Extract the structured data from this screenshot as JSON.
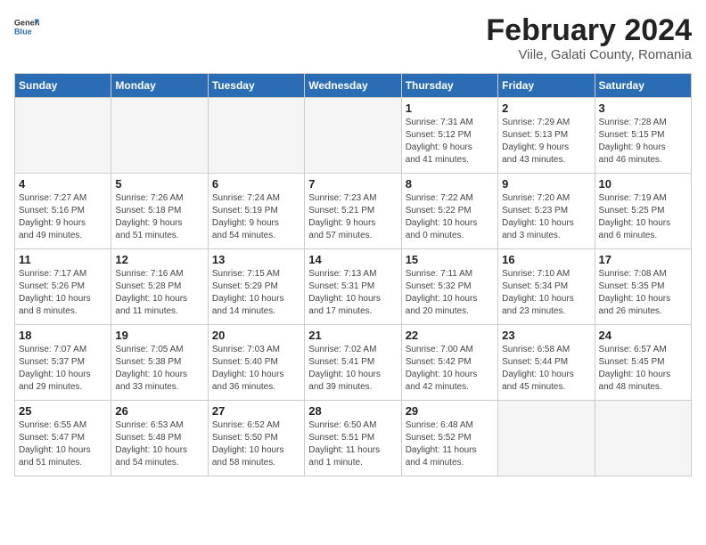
{
  "header": {
    "logo_general": "General",
    "logo_blue": "Blue",
    "month": "February 2024",
    "location": "Viile, Galati County, Romania"
  },
  "days_of_week": [
    "Sunday",
    "Monday",
    "Tuesday",
    "Wednesday",
    "Thursday",
    "Friday",
    "Saturday"
  ],
  "weeks": [
    [
      {
        "day": "",
        "info": ""
      },
      {
        "day": "",
        "info": ""
      },
      {
        "day": "",
        "info": ""
      },
      {
        "day": "",
        "info": ""
      },
      {
        "day": "1",
        "info": "Sunrise: 7:31 AM\nSunset: 5:12 PM\nDaylight: 9 hours\nand 41 minutes."
      },
      {
        "day": "2",
        "info": "Sunrise: 7:29 AM\nSunset: 5:13 PM\nDaylight: 9 hours\nand 43 minutes."
      },
      {
        "day": "3",
        "info": "Sunrise: 7:28 AM\nSunset: 5:15 PM\nDaylight: 9 hours\nand 46 minutes."
      }
    ],
    [
      {
        "day": "4",
        "info": "Sunrise: 7:27 AM\nSunset: 5:16 PM\nDaylight: 9 hours\nand 49 minutes."
      },
      {
        "day": "5",
        "info": "Sunrise: 7:26 AM\nSunset: 5:18 PM\nDaylight: 9 hours\nand 51 minutes."
      },
      {
        "day": "6",
        "info": "Sunrise: 7:24 AM\nSunset: 5:19 PM\nDaylight: 9 hours\nand 54 minutes."
      },
      {
        "day": "7",
        "info": "Sunrise: 7:23 AM\nSunset: 5:21 PM\nDaylight: 9 hours\nand 57 minutes."
      },
      {
        "day": "8",
        "info": "Sunrise: 7:22 AM\nSunset: 5:22 PM\nDaylight: 10 hours\nand 0 minutes."
      },
      {
        "day": "9",
        "info": "Sunrise: 7:20 AM\nSunset: 5:23 PM\nDaylight: 10 hours\nand 3 minutes."
      },
      {
        "day": "10",
        "info": "Sunrise: 7:19 AM\nSunset: 5:25 PM\nDaylight: 10 hours\nand 6 minutes."
      }
    ],
    [
      {
        "day": "11",
        "info": "Sunrise: 7:17 AM\nSunset: 5:26 PM\nDaylight: 10 hours\nand 8 minutes."
      },
      {
        "day": "12",
        "info": "Sunrise: 7:16 AM\nSunset: 5:28 PM\nDaylight: 10 hours\nand 11 minutes."
      },
      {
        "day": "13",
        "info": "Sunrise: 7:15 AM\nSunset: 5:29 PM\nDaylight: 10 hours\nand 14 minutes."
      },
      {
        "day": "14",
        "info": "Sunrise: 7:13 AM\nSunset: 5:31 PM\nDaylight: 10 hours\nand 17 minutes."
      },
      {
        "day": "15",
        "info": "Sunrise: 7:11 AM\nSunset: 5:32 PM\nDaylight: 10 hours\nand 20 minutes."
      },
      {
        "day": "16",
        "info": "Sunrise: 7:10 AM\nSunset: 5:34 PM\nDaylight: 10 hours\nand 23 minutes."
      },
      {
        "day": "17",
        "info": "Sunrise: 7:08 AM\nSunset: 5:35 PM\nDaylight: 10 hours\nand 26 minutes."
      }
    ],
    [
      {
        "day": "18",
        "info": "Sunrise: 7:07 AM\nSunset: 5:37 PM\nDaylight: 10 hours\nand 29 minutes."
      },
      {
        "day": "19",
        "info": "Sunrise: 7:05 AM\nSunset: 5:38 PM\nDaylight: 10 hours\nand 33 minutes."
      },
      {
        "day": "20",
        "info": "Sunrise: 7:03 AM\nSunset: 5:40 PM\nDaylight: 10 hours\nand 36 minutes."
      },
      {
        "day": "21",
        "info": "Sunrise: 7:02 AM\nSunset: 5:41 PM\nDaylight: 10 hours\nand 39 minutes."
      },
      {
        "day": "22",
        "info": "Sunrise: 7:00 AM\nSunset: 5:42 PM\nDaylight: 10 hours\nand 42 minutes."
      },
      {
        "day": "23",
        "info": "Sunrise: 6:58 AM\nSunset: 5:44 PM\nDaylight: 10 hours\nand 45 minutes."
      },
      {
        "day": "24",
        "info": "Sunrise: 6:57 AM\nSunset: 5:45 PM\nDaylight: 10 hours\nand 48 minutes."
      }
    ],
    [
      {
        "day": "25",
        "info": "Sunrise: 6:55 AM\nSunset: 5:47 PM\nDaylight: 10 hours\nand 51 minutes."
      },
      {
        "day": "26",
        "info": "Sunrise: 6:53 AM\nSunset: 5:48 PM\nDaylight: 10 hours\nand 54 minutes."
      },
      {
        "day": "27",
        "info": "Sunrise: 6:52 AM\nSunset: 5:50 PM\nDaylight: 10 hours\nand 58 minutes."
      },
      {
        "day": "28",
        "info": "Sunrise: 6:50 AM\nSunset: 5:51 PM\nDaylight: 11 hours\nand 1 minute."
      },
      {
        "day": "29",
        "info": "Sunrise: 6:48 AM\nSunset: 5:52 PM\nDaylight: 11 hours\nand 4 minutes."
      },
      {
        "day": "",
        "info": ""
      },
      {
        "day": "",
        "info": ""
      }
    ]
  ]
}
